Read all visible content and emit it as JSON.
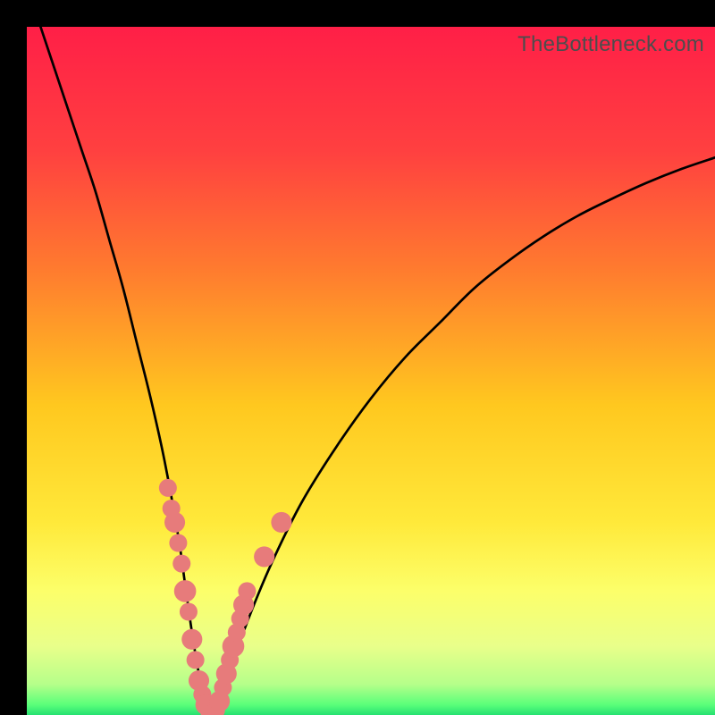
{
  "watermark": "TheBottleneck.com",
  "gradient": {
    "stops": [
      {
        "offset": 0.0,
        "color": "#ff1f47"
      },
      {
        "offset": 0.18,
        "color": "#ff4040"
      },
      {
        "offset": 0.35,
        "color": "#ff7a2f"
      },
      {
        "offset": 0.55,
        "color": "#ffc81f"
      },
      {
        "offset": 0.72,
        "color": "#ffe93a"
      },
      {
        "offset": 0.82,
        "color": "#fcff6a"
      },
      {
        "offset": 0.9,
        "color": "#e9ff8a"
      },
      {
        "offset": 0.955,
        "color": "#b6ff8a"
      },
      {
        "offset": 0.985,
        "color": "#5bff7a"
      },
      {
        "offset": 1.0,
        "color": "#26e071"
      }
    ]
  },
  "chart_data": {
    "type": "line",
    "title": "",
    "xlabel": "",
    "ylabel": "",
    "xlim": [
      0,
      100
    ],
    "ylim": [
      0,
      100
    ],
    "series": [
      {
        "name": "bottleneck-curve",
        "x": [
          2,
          4,
          6,
          8,
          10,
          12,
          14,
          16,
          18,
          20,
          22,
          23,
          24,
          25,
          26,
          27,
          28,
          30,
          33,
          36,
          40,
          45,
          50,
          55,
          60,
          65,
          70,
          75,
          80,
          85,
          90,
          95,
          100
        ],
        "values": [
          100,
          94,
          88,
          82,
          76,
          69,
          62,
          54,
          46,
          37,
          26,
          19,
          12,
          6,
          2,
          0,
          2,
          8,
          16,
          23,
          31,
          39,
          46,
          52,
          57,
          62,
          66,
          69.5,
          72.5,
          75,
          77.3,
          79.3,
          81
        ]
      }
    ],
    "markers": {
      "name": "highlight-points",
      "color": "#e77b7b",
      "points": [
        {
          "x": 20.5,
          "y": 33,
          "r": 1.3
        },
        {
          "x": 21.0,
          "y": 30,
          "r": 1.3
        },
        {
          "x": 21.5,
          "y": 28,
          "r": 1.5
        },
        {
          "x": 22.0,
          "y": 25,
          "r": 1.3
        },
        {
          "x": 22.5,
          "y": 22,
          "r": 1.3
        },
        {
          "x": 23.0,
          "y": 18,
          "r": 1.6
        },
        {
          "x": 23.5,
          "y": 15,
          "r": 1.3
        },
        {
          "x": 24.0,
          "y": 11,
          "r": 1.5
        },
        {
          "x": 24.5,
          "y": 8,
          "r": 1.3
        },
        {
          "x": 25.0,
          "y": 5,
          "r": 1.5
        },
        {
          "x": 25.5,
          "y": 3,
          "r": 1.3
        },
        {
          "x": 26.0,
          "y": 1.5,
          "r": 1.5
        },
        {
          "x": 26.5,
          "y": 0.5,
          "r": 1.3
        },
        {
          "x": 27.0,
          "y": 0.3,
          "r": 1.3
        },
        {
          "x": 27.5,
          "y": 0.7,
          "r": 1.3
        },
        {
          "x": 28.0,
          "y": 2,
          "r": 1.5
        },
        {
          "x": 28.5,
          "y": 4,
          "r": 1.3
        },
        {
          "x": 29.0,
          "y": 6,
          "r": 1.5
        },
        {
          "x": 29.5,
          "y": 8,
          "r": 1.3
        },
        {
          "x": 30.0,
          "y": 10,
          "r": 1.6
        },
        {
          "x": 30.5,
          "y": 12,
          "r": 1.3
        },
        {
          "x": 31.0,
          "y": 14,
          "r": 1.3
        },
        {
          "x": 31.5,
          "y": 16,
          "r": 1.5
        },
        {
          "x": 32.0,
          "y": 18,
          "r": 1.3
        },
        {
          "x": 34.5,
          "y": 23,
          "r": 1.5
        },
        {
          "x": 37.0,
          "y": 28,
          "r": 1.5
        }
      ]
    }
  }
}
